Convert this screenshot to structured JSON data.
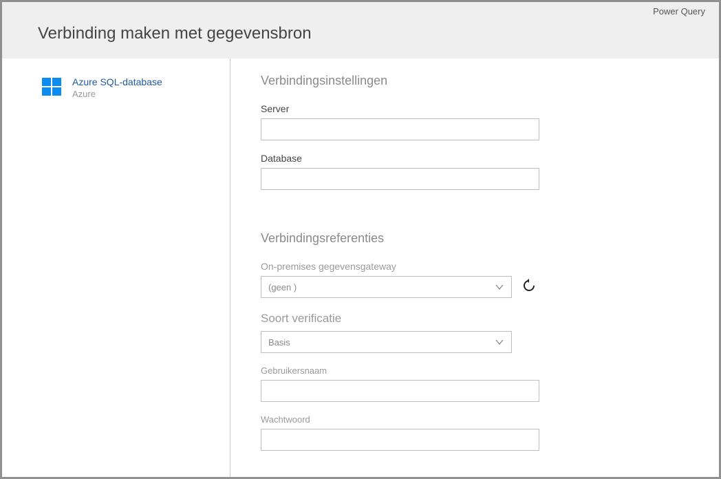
{
  "app_name": "Power Query",
  "page_title": "Verbinding maken met gegevensbron",
  "sidebar": {
    "source": {
      "title": "Azure SQL-database",
      "subtitle": "Azure",
      "icon": "windows-logo-icon"
    }
  },
  "settings": {
    "section_title": "Verbindingsinstellingen",
    "server_label": "Server",
    "server_value": "",
    "database_label": "Database",
    "database_value": ""
  },
  "credentials": {
    "section_title": "Verbindingsreferenties",
    "gateway_label": "On-premises gegevensgateway",
    "gateway_value": "(geen )",
    "auth_label": "Soort verificatie",
    "auth_value": "Basis",
    "username_label": "Gebruikersnaam",
    "username_value": "",
    "password_label": "Wachtwoord",
    "password_value": ""
  }
}
